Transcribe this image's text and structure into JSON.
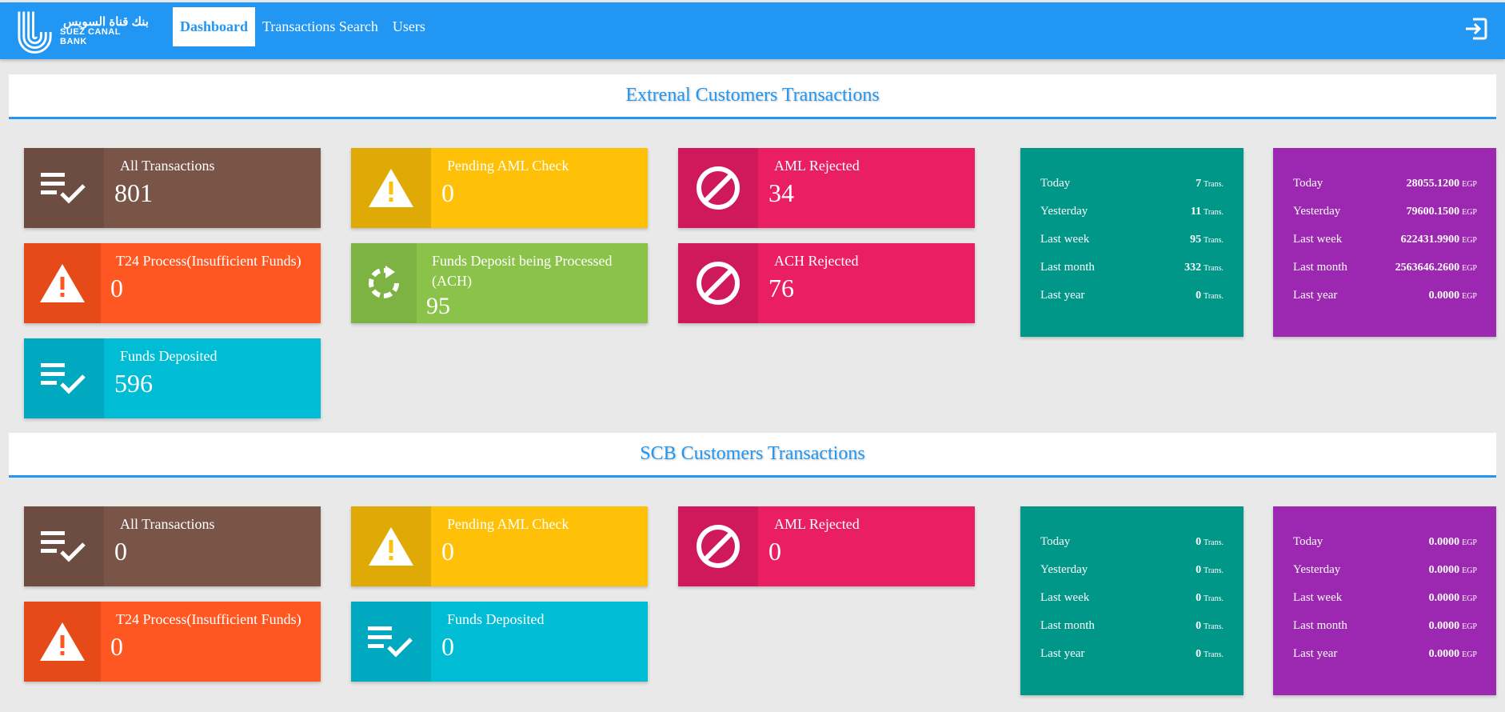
{
  "brand": {
    "arabic": "بنك قناة السويس",
    "english": "SUEZ CANAL BANK"
  },
  "nav": [
    {
      "label": "Dashboard",
      "active": true
    },
    {
      "label": "Transactions Search",
      "active": false
    },
    {
      "label": "Users",
      "active": false
    }
  ],
  "external": {
    "title": "Extrenal Customers Transactions",
    "tiles": {
      "all": {
        "label": "All Transactions",
        "value": "801"
      },
      "pending": {
        "label": "Pending AML Check",
        "value": "0"
      },
      "aml_rejected": {
        "label": "AML Rejected",
        "value": "34"
      },
      "t24": {
        "label": "T24 Process(Insufficient Funds)",
        "value": "0"
      },
      "funds_processing": {
        "label": "Funds Deposit being Processed (ACH)",
        "value": "95"
      },
      "ach_rejected": {
        "label": "ACH Rejected",
        "value": "76"
      },
      "funds_deposited": {
        "label": "Funds Deposited",
        "value": "596"
      }
    },
    "counts": [
      {
        "period": "Today",
        "value": "7",
        "unit": "Trans."
      },
      {
        "period": "Yesterday",
        "value": "11",
        "unit": "Trans."
      },
      {
        "period": "Last week",
        "value": "95",
        "unit": "Trans."
      },
      {
        "period": "Last month",
        "value": "332",
        "unit": "Trans."
      },
      {
        "period": "Last year",
        "value": "0",
        "unit": "Trans."
      }
    ],
    "amounts": [
      {
        "period": "Today",
        "value": "28055.1200",
        "unit": "EGP"
      },
      {
        "period": "Yesterday",
        "value": "79600.1500",
        "unit": "EGP"
      },
      {
        "period": "Last week",
        "value": "622431.9900",
        "unit": "EGP"
      },
      {
        "period": "Last month",
        "value": "2563646.2600",
        "unit": "EGP"
      },
      {
        "period": "Last year",
        "value": "0.0000",
        "unit": "EGP"
      }
    ]
  },
  "scb": {
    "title": "SCB Customers Transactions",
    "tiles": {
      "all": {
        "label": "All Transactions",
        "value": "0"
      },
      "pending": {
        "label": "Pending AML Check",
        "value": "0"
      },
      "aml_rejected": {
        "label": "AML Rejected",
        "value": "0"
      },
      "t24": {
        "label": "T24 Process(Insufficient Funds)",
        "value": "0"
      },
      "funds_deposited": {
        "label": "Funds Deposited",
        "value": "0"
      }
    },
    "counts": [
      {
        "period": "Today",
        "value": "0",
        "unit": "Trans."
      },
      {
        "period": "Yesterday",
        "value": "0",
        "unit": "Trans."
      },
      {
        "period": "Last week",
        "value": "0",
        "unit": "Trans."
      },
      {
        "period": "Last month",
        "value": "0",
        "unit": "Trans."
      },
      {
        "period": "Last year",
        "value": "0",
        "unit": "Trans."
      }
    ],
    "amounts": [
      {
        "period": "Today",
        "value": "0.0000",
        "unit": "EGP"
      },
      {
        "period": "Yesterday",
        "value": "0.0000",
        "unit": "EGP"
      },
      {
        "period": "Last week",
        "value": "0.0000",
        "unit": "EGP"
      },
      {
        "period": "Last month",
        "value": "0.0000",
        "unit": "EGP"
      },
      {
        "period": "Last year",
        "value": "0.0000",
        "unit": "EGP"
      }
    ]
  }
}
